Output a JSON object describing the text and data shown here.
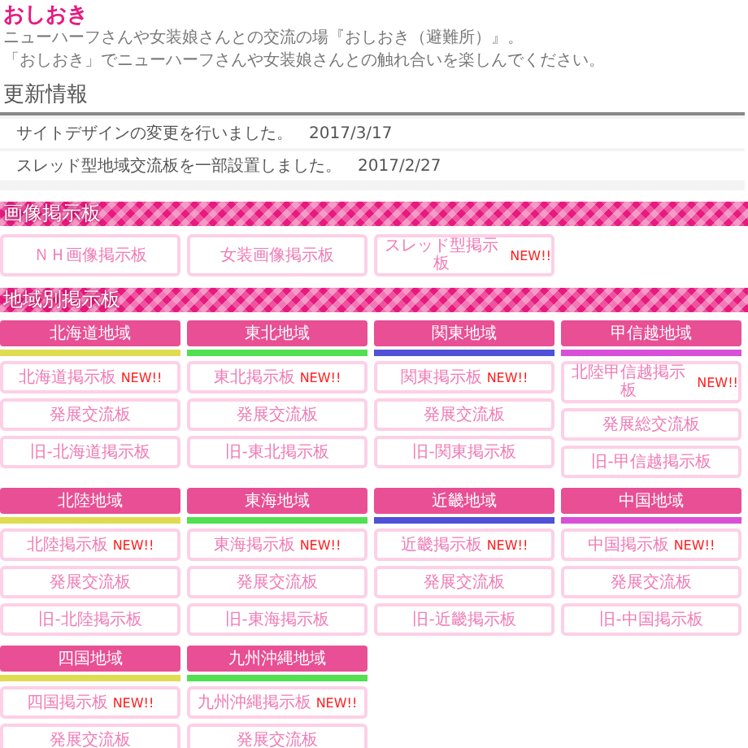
{
  "site_title": "おしおき",
  "description": [
    "ニューハーフさんや女装娘さんとの交流の場『おしおき（避難所）』。",
    "「おしおき」でニューハーフさんや女装娘さんとの触れ合いを楽しんでください。"
  ],
  "updates": {
    "heading": "更新情報",
    "items": [
      {
        "text": "サイトデザインの変更を行いました。",
        "date": "2017/3/17"
      },
      {
        "text": "スレッド型地域交流板を一部設置しました。",
        "date": "2017/2/27"
      }
    ]
  },
  "image_boards": {
    "heading": "画像掲示板",
    "boards": [
      {
        "label": "ＮＨ画像掲示板"
      },
      {
        "label": "女装画像掲示板"
      },
      {
        "label": "スレッド型掲示板",
        "badge": "NEW!!"
      }
    ]
  },
  "regional": {
    "heading": "地域別掲示板",
    "regions": [
      {
        "name": "北海道地域",
        "color": "#e0dc50",
        "boards": [
          {
            "label": "北海道掲示板",
            "badge": "NEW!!"
          },
          {
            "label": "発展交流板"
          },
          {
            "label": "旧-北海道掲示板"
          }
        ]
      },
      {
        "name": "東北地域",
        "color": "#50e050",
        "boards": [
          {
            "label": "東北掲示板",
            "badge": "NEW!!"
          },
          {
            "label": "発展交流板"
          },
          {
            "label": "旧-東北掲示板"
          }
        ]
      },
      {
        "name": "関東地域",
        "color": "#5050d8",
        "boards": [
          {
            "label": "関東掲示板",
            "badge": "NEW!!"
          },
          {
            "label": "発展交流板"
          },
          {
            "label": "旧-関東掲示板"
          }
        ]
      },
      {
        "name": "甲信越地域",
        "color": "#d850d8",
        "boards": [
          {
            "label": "北陸甲信越掲示板",
            "badge": "NEW!!"
          },
          {
            "label": "発展総交流板"
          },
          {
            "label": "旧-甲信越掲示板"
          }
        ]
      },
      {
        "name": "北陸地域",
        "color": "#e0dc50",
        "boards": [
          {
            "label": "北陸掲示板",
            "badge": "NEW!!"
          },
          {
            "label": "発展交流板"
          },
          {
            "label": "旧-北陸掲示板"
          }
        ]
      },
      {
        "name": "東海地域",
        "color": "#50e050",
        "boards": [
          {
            "label": "東海掲示板",
            "badge": "NEW!!"
          },
          {
            "label": "発展交流板"
          },
          {
            "label": "旧-東海掲示板"
          }
        ]
      },
      {
        "name": "近畿地域",
        "color": "#5050d8",
        "boards": [
          {
            "label": "近畿掲示板",
            "badge": "NEW!!"
          },
          {
            "label": "発展交流板"
          },
          {
            "label": "旧-近畿掲示板"
          }
        ]
      },
      {
        "name": "中国地域",
        "color": "#d850d8",
        "boards": [
          {
            "label": "中国掲示板",
            "badge": "NEW!!"
          },
          {
            "label": "発展交流板"
          },
          {
            "label": "旧-中国掲示板"
          }
        ]
      },
      {
        "name": "四国地域",
        "color": "#e0dc50",
        "boards": [
          {
            "label": "四国掲示板",
            "badge": "NEW!!"
          },
          {
            "label": "発展交流板"
          }
        ]
      },
      {
        "name": "九州沖縄地域",
        "color": "#50e050",
        "boards": [
          {
            "label": "九州沖縄掲示板",
            "badge": "NEW!!"
          },
          {
            "label": "発展交流板"
          }
        ]
      }
    ]
  }
}
